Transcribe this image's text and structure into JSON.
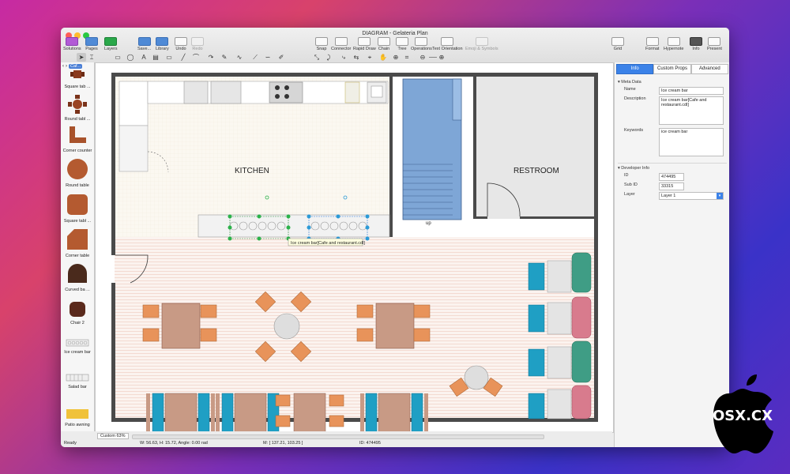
{
  "window": {
    "title": "DIAGRAM - Gelateria Plan"
  },
  "toolbar": {
    "solutions": "Solutions",
    "pages": "Pages",
    "layers": "Layers",
    "save": "Save...",
    "library": "Library",
    "undo": "Undo",
    "redo": "Redo",
    "snap": "Snap",
    "connector": "Connector",
    "rapid_draw": "Rapid Draw",
    "chain": "Chain",
    "tree": "Tree",
    "operations": "Operations",
    "text_orientation": "Text Orientation",
    "emoji": "Emoji & Symbols",
    "grid": "Grid",
    "format": "Format",
    "hypernote": "Hypernote",
    "info": "Info",
    "present": "Present"
  },
  "library": {
    "selected": "Caf...",
    "items": [
      {
        "label": "Square tab ..."
      },
      {
        "label": "Round tabl ..."
      },
      {
        "label": "Corner counter"
      },
      {
        "label": "Round table"
      },
      {
        "label": "Square tabl ..."
      },
      {
        "label": "Corner table"
      },
      {
        "label": "Curved ba ..."
      },
      {
        "label": "Chair 2"
      },
      {
        "label": "Ice cream bar"
      },
      {
        "label": "Salad bar"
      },
      {
        "label": "Patio awning"
      }
    ]
  },
  "canvas": {
    "kitchen_label": "KITCHEN",
    "restroom_label": "RESTROOM",
    "stairs_label": "up",
    "tooltip": "Ice cream bar[Cafe and restaurant.cdl]"
  },
  "status": {
    "zoom": "Custom 63%",
    "ready": "Ready",
    "size": "W: 56.63,  H: 15.72,  Angle: 0.00 rad",
    "mouse": "M: [ 137.21, 103.25 ]",
    "id": "ID: 474495"
  },
  "inspector": {
    "tabs": [
      "Info",
      "Custom Props",
      "Advanced"
    ],
    "meta_title": "Meta Data",
    "name_label": "Name",
    "name_value": "Ice cream bar",
    "desc_label": "Description",
    "desc_value": "Ice cream bar[Cafe and restaurant.cdl]",
    "keywords_label": "Keywords",
    "keywords_value": "ice cream bar",
    "dev_title": "Developer Info",
    "id_label": "ID",
    "id_value": "474495",
    "subid_label": "Sub ID",
    "subid_value": "33315",
    "layer_label": "Layer",
    "layer_value": "Layer 1"
  },
  "badge": {
    "text": "OSX.CX"
  },
  "colors": {
    "accent": "#3b82e8",
    "chair": "#e8935a",
    "table": "#c89a85",
    "booth": "#1f9fc4",
    "armchair_teal": "#3f9d85",
    "armchair_pink": "#d87b8d",
    "stairs": "#7ea6d6"
  }
}
